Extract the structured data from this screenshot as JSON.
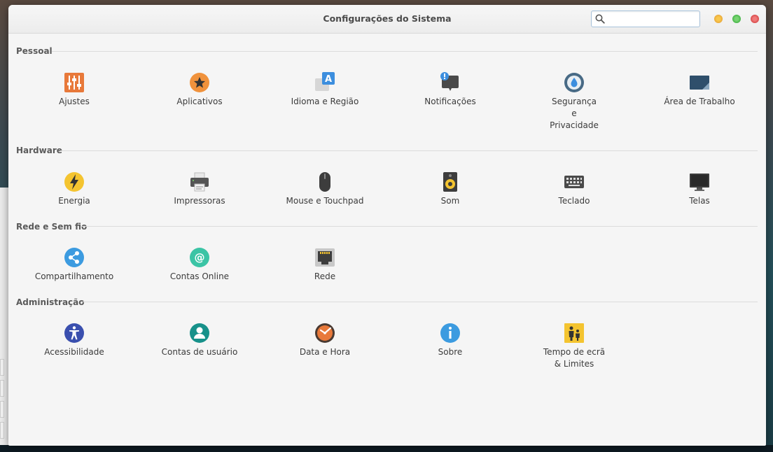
{
  "window": {
    "title": "Configurações do Sistema"
  },
  "search": {
    "value": "",
    "placeholder": ""
  },
  "sections": [
    {
      "header": "Pessoal",
      "items": [
        {
          "label": "Ajustes",
          "icon": "sliders-icon"
        },
        {
          "label": "Aplicativos",
          "icon": "star-icon"
        },
        {
          "label": "Idioma e Região",
          "icon": "language-icon"
        },
        {
          "label": "Notificações",
          "icon": "notification-icon"
        },
        {
          "label": "Segurança\ne\nPrivacidade",
          "icon": "privacy-icon"
        },
        {
          "label": "Área de Trabalho",
          "icon": "desktop-icon"
        }
      ]
    },
    {
      "header": "Hardware",
      "items": [
        {
          "label": "Energia",
          "icon": "power-icon"
        },
        {
          "label": "Impressoras",
          "icon": "printer-icon"
        },
        {
          "label": "Mouse e Touchpad",
          "icon": "mouse-icon"
        },
        {
          "label": "Som",
          "icon": "speaker-icon"
        },
        {
          "label": "Teclado",
          "icon": "keyboard-icon"
        },
        {
          "label": "Telas",
          "icon": "display-icon"
        }
      ]
    },
    {
      "header": "Rede e Sem fio",
      "items": [
        {
          "label": "Compartilhamento",
          "icon": "share-icon"
        },
        {
          "label": "Contas Online",
          "icon": "online-accounts-icon"
        },
        {
          "label": "Rede",
          "icon": "network-icon"
        }
      ]
    },
    {
      "header": "Administração",
      "items": [
        {
          "label": "Acessibilidade",
          "icon": "accessibility-icon"
        },
        {
          "label": "Contas de usuário",
          "icon": "user-accounts-icon"
        },
        {
          "label": "Data e Hora",
          "icon": "clock-icon"
        },
        {
          "label": "Sobre",
          "icon": "info-icon"
        },
        {
          "label": "Tempo de ecrã\n& Limites",
          "icon": "screen-time-icon"
        }
      ]
    }
  ]
}
